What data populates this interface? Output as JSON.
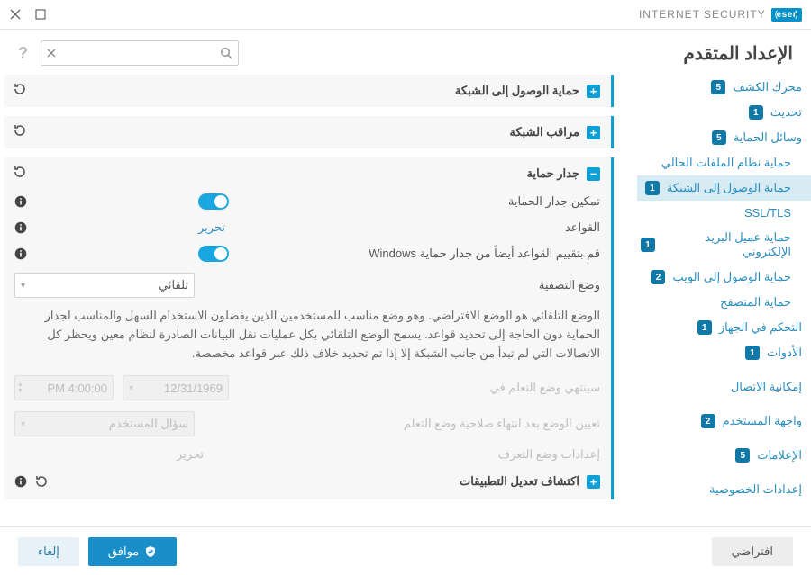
{
  "brand": {
    "badge": "eser",
    "text": "INTERNET SECURITY"
  },
  "page_title": "الإعداد المتقدم",
  "search": {
    "value": ""
  },
  "sidebar": [
    {
      "label": "محرك الكشف",
      "badge": "5",
      "sub": false
    },
    {
      "label": "تحديث",
      "badge": "1",
      "sub": false
    },
    {
      "label": "وسائل الحماية",
      "badge": "5",
      "sub": false
    },
    {
      "label": "حماية نظام الملفات الحالي",
      "badge": "",
      "sub": true
    },
    {
      "label": "حماية الوصول إلى الشبكة",
      "badge": "1",
      "sub": true,
      "active": true
    },
    {
      "label": "SSL/TLS",
      "badge": "",
      "sub": true
    },
    {
      "label": "حماية عميل البريد الإلكتروني",
      "badge": "1",
      "sub": true
    },
    {
      "label": "حماية الوصول إلى الويب",
      "badge": "2",
      "sub": true
    },
    {
      "label": "حماية المتصفح",
      "badge": "",
      "sub": true
    },
    {
      "label": "التحكم في الجهاز",
      "badge": "1",
      "sub": false
    },
    {
      "label": "الأدوات",
      "badge": "1",
      "sub": false
    },
    {
      "label": "إمكانية الاتصال",
      "badge": "",
      "sub": false
    },
    {
      "label": "واجهة المستخدم",
      "badge": "2",
      "sub": false
    },
    {
      "label": "الإعلامات",
      "badge": "5",
      "sub": false
    },
    {
      "label": "إعدادات الخصوصية",
      "badge": "",
      "sub": false
    }
  ],
  "sections": {
    "s0": {
      "title": "حماية الوصول إلى الشبكة"
    },
    "s1": {
      "title": "مراقب الشبكة"
    },
    "fw": {
      "title": "جدار حماية",
      "enable_label": "تمكين جدار الحماية",
      "rules_label": "القواعد",
      "rules_action": "تحرير",
      "winfw_label": "قم بتقييم القواعد أيضاً من جدار حماية Windows",
      "mode_label": "وضع التصفية",
      "mode_value": "تلقائي",
      "mode_desc": "الوضع التلقائي هو الوضع الافتراضي. وهو وضع مناسب للمستخدمين الذين يفضلون الاستخدام السهل والمناسب لجدار الحماية دون الحاجة إلى تحديد قواعد. يسمح الوضع التلقائي بكل عمليات نقل البيانات الصادرة لنظام معين ويحظر كل الاتصالات التي لم تبدأ من جانب الشبكة إلا إذا تم تحديد خلاف ذلك عبر قواعد مخصصة.",
      "learn_end_label": "سينتهي وضع التعلم في",
      "learn_end_date": "12/31/1969",
      "learn_end_time": "PM 4:00:00",
      "after_learn_label": "تعيين الوضع بعد انتهاء صلاحية وضع التعلم",
      "after_learn_value": "سؤال المستخدم",
      "learn_settings_label": "إعدادات وضع التعرف",
      "learn_settings_action": "تحرير",
      "appmod_title": "اكتشاف تعديل التطبيقات"
    }
  },
  "footer": {
    "default": "افتراضي",
    "ok": "موافق",
    "cancel": "إلغاء"
  }
}
